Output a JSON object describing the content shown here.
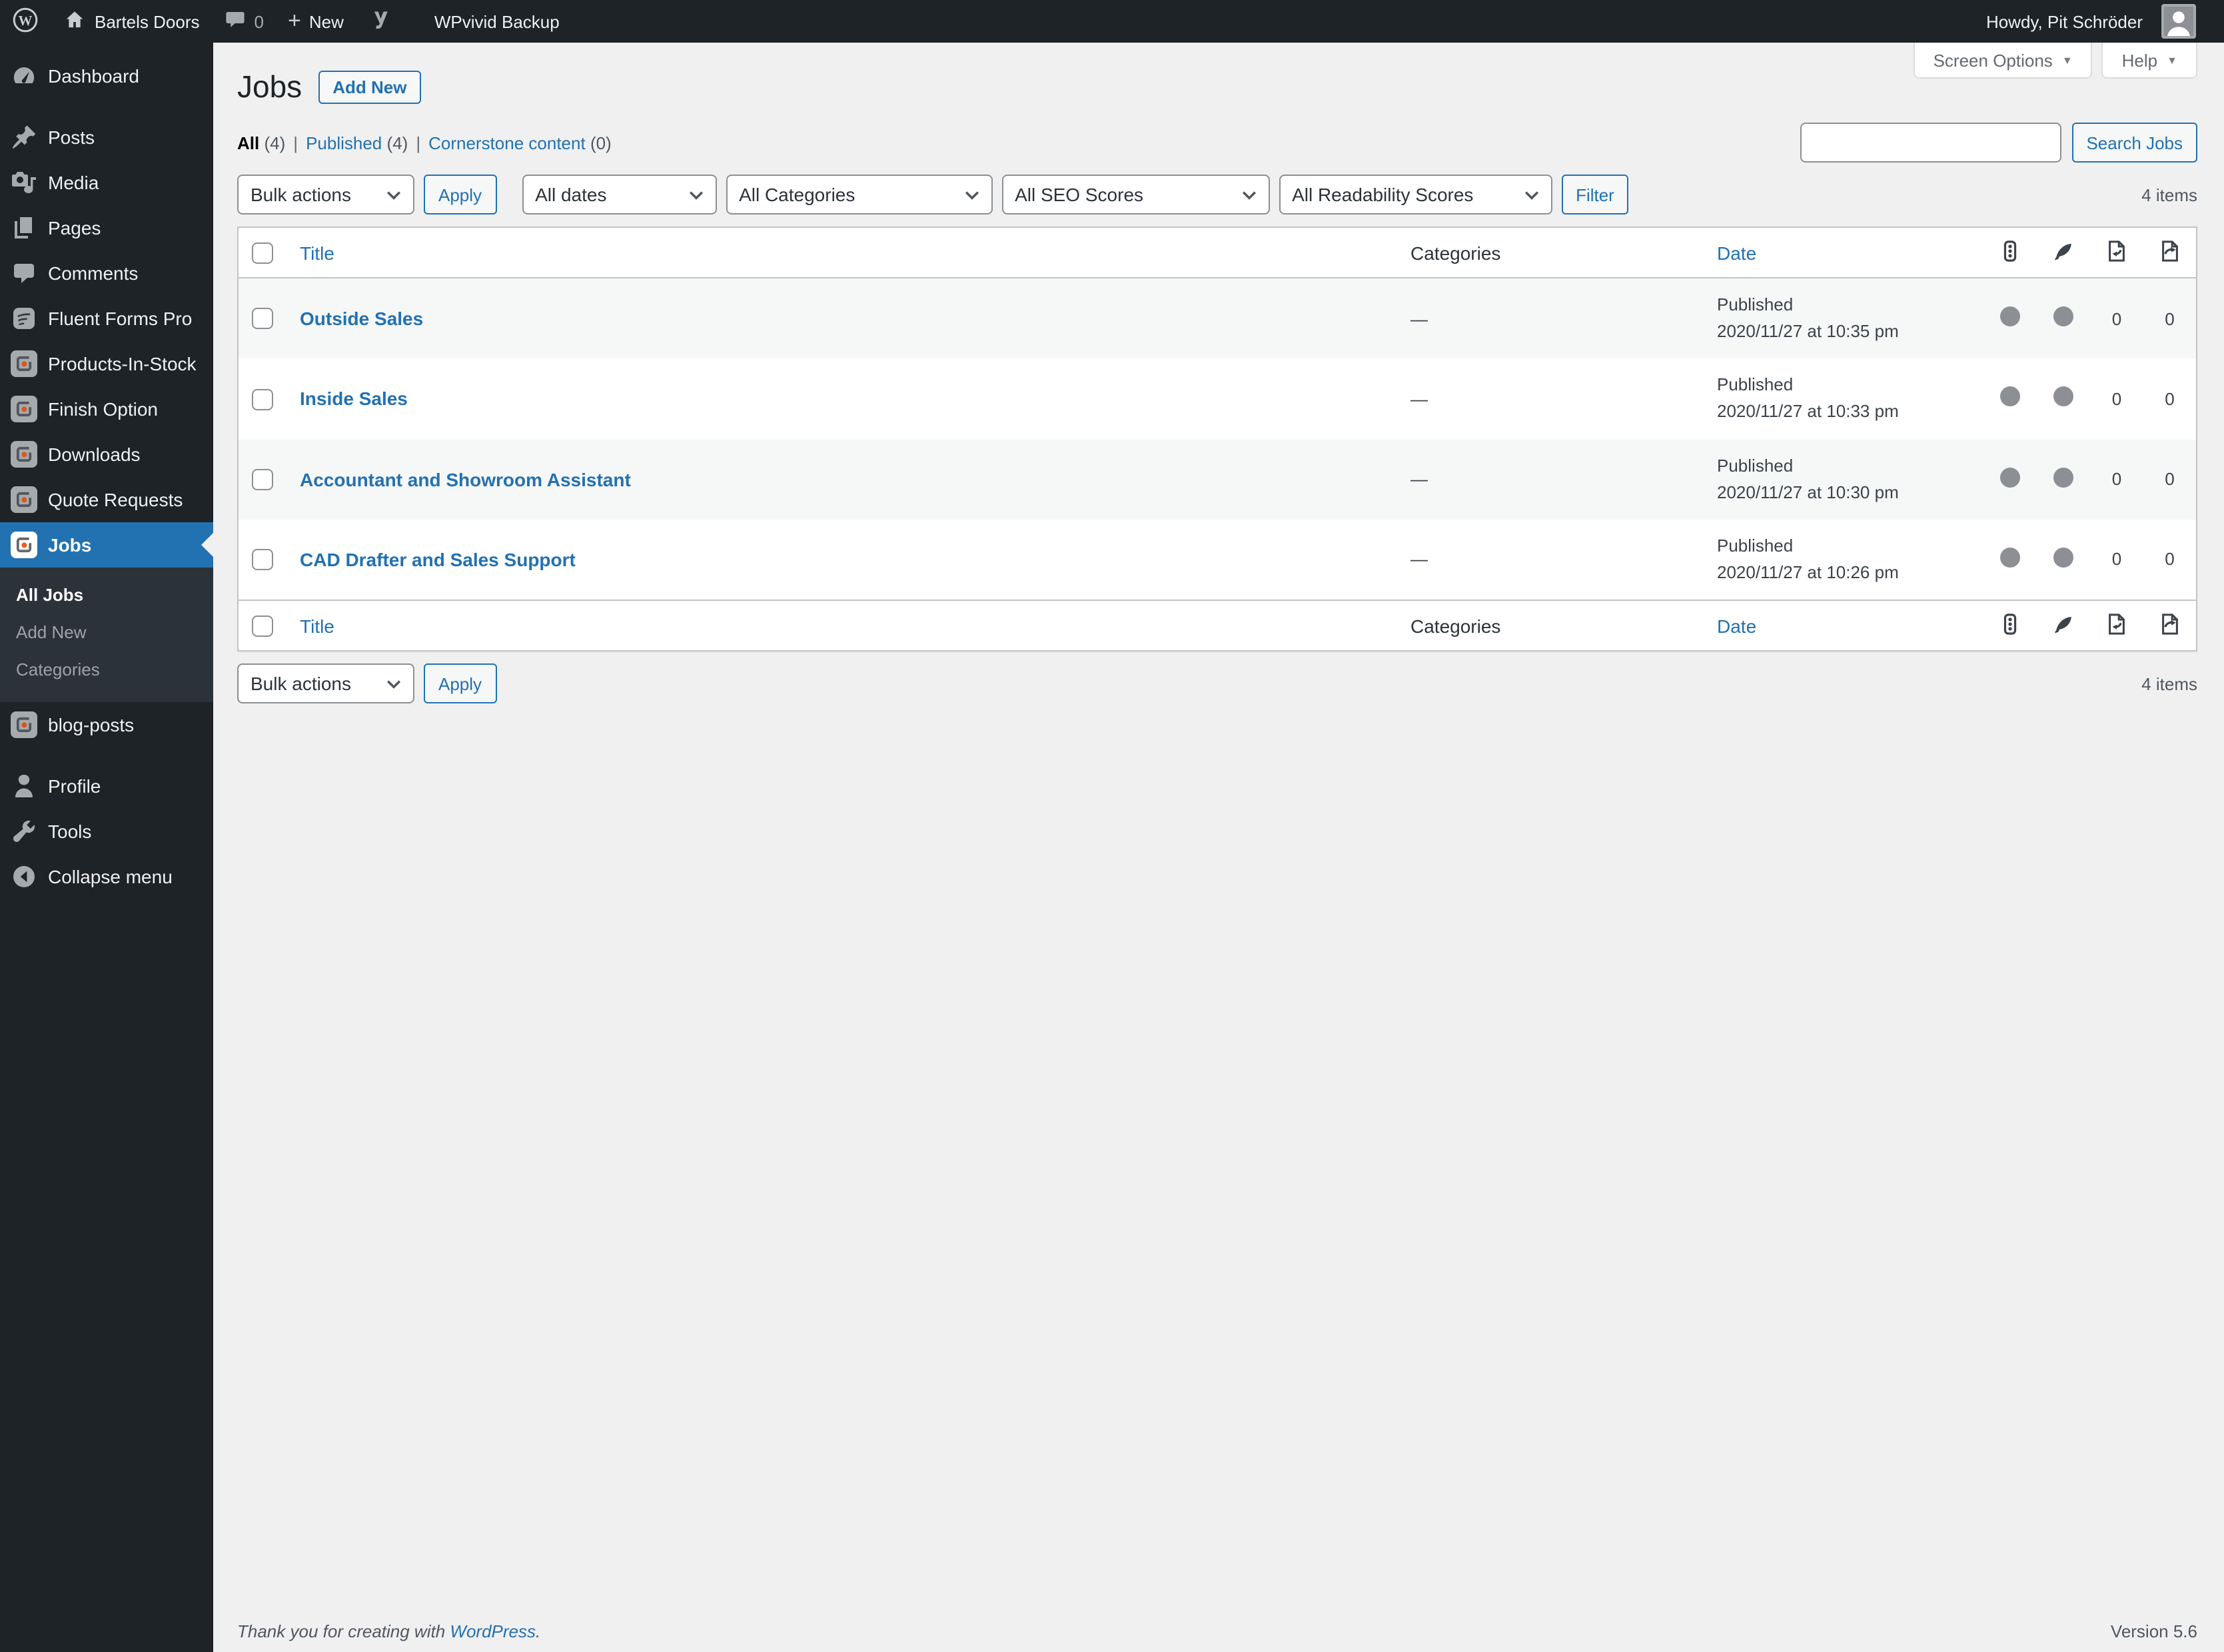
{
  "admin_bar": {
    "site_name": "Bartels Doors",
    "comments_count": "0",
    "new_label": "New",
    "wpvivid_label": "WPvivid Backup",
    "howdy": "Howdy, Pit Schröder"
  },
  "sidebar": {
    "items": [
      {
        "label": "Dashboard"
      },
      {
        "label": "Posts"
      },
      {
        "label": "Media"
      },
      {
        "label": "Pages"
      },
      {
        "label": "Comments"
      },
      {
        "label": "Fluent Forms Pro"
      },
      {
        "label": "Products-In-Stock"
      },
      {
        "label": "Finish Option"
      },
      {
        "label": "Downloads"
      },
      {
        "label": "Quote Requests"
      },
      {
        "label": "Jobs"
      },
      {
        "label": "blog-posts"
      },
      {
        "label": "Profile"
      },
      {
        "label": "Tools"
      },
      {
        "label": "Collapse menu"
      }
    ],
    "jobs_submenu": [
      {
        "label": "All Jobs"
      },
      {
        "label": "Add New"
      },
      {
        "label": "Categories"
      }
    ]
  },
  "page": {
    "title": "Jobs",
    "add_new_label": "Add New",
    "screen_options_label": "Screen Options",
    "help_label": "Help"
  },
  "views": [
    {
      "label": "All",
      "count": "(4)"
    },
    {
      "label": "Published",
      "count": "(4)"
    },
    {
      "label": "Cornerstone content",
      "count": "(0)"
    }
  ],
  "filters": {
    "bulk_actions": "Bulk actions",
    "apply_label": "Apply",
    "all_dates": "All dates",
    "all_categories": "All Categories",
    "all_seo_scores": "All SEO Scores",
    "all_readability_scores": "All Readability Scores",
    "filter_label": "Filter"
  },
  "search": {
    "button_label": "Search Jobs",
    "value": ""
  },
  "counts": {
    "top": "4 items",
    "bottom": "4 items"
  },
  "table": {
    "headers": {
      "title": "Title",
      "categories": "Categories",
      "date": "Date"
    },
    "rows": [
      {
        "title": "Outside Sales",
        "categories": "—",
        "status": "Published",
        "date": "2020/11/27 at 10:35 pm",
        "links": "0",
        "linked": "0"
      },
      {
        "title": "Inside Sales",
        "categories": "—",
        "status": "Published",
        "date": "2020/11/27 at 10:33 pm",
        "links": "0",
        "linked": "0"
      },
      {
        "title": "Accountant and Showroom Assistant",
        "categories": "—",
        "status": "Published",
        "date": "2020/11/27 at 10:30 pm",
        "links": "0",
        "linked": "0"
      },
      {
        "title": "CAD Drafter and Sales Support",
        "categories": "—",
        "status": "Published",
        "date": "2020/11/27 at 10:26 pm",
        "links": "0",
        "linked": "0"
      }
    ]
  },
  "footer": {
    "thanks_prefix": "Thank you for creating with",
    "wordpress_link": "WordPress",
    "thanks_suffix": ".",
    "version": "Version 5.6"
  },
  "colors": {
    "accent": "#2271b1",
    "admin_bar_bg": "#1d2327",
    "submenu_bg": "#2c3338",
    "content_bg": "#f0f0f1",
    "row_stripe": "#f6f7f7",
    "score_dot": "#8c8f94",
    "cpt_icon_dot": "#d9571e"
  }
}
